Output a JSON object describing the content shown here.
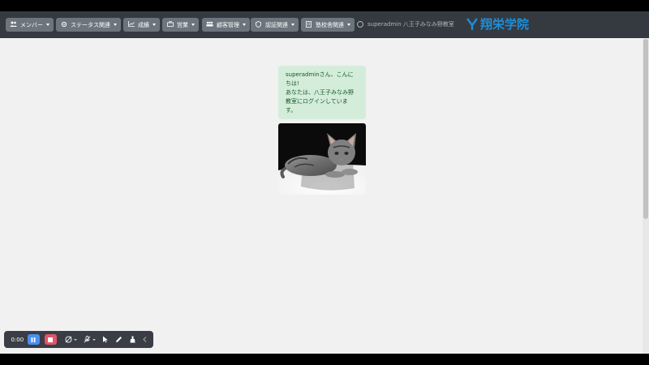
{
  "nav": {
    "items": [
      {
        "label": "メンバー",
        "icon": "users-icon"
      },
      {
        "label": "ステータス関連",
        "icon": "gear-icon"
      },
      {
        "label": "成績",
        "icon": "chart-line-icon"
      },
      {
        "label": "営業",
        "icon": "briefcase-icon"
      },
      {
        "label": "顧客管理",
        "icon": "customers-icon"
      },
      {
        "label": "認証関連",
        "icon": "shield-icon"
      },
      {
        "label": "塾校舎関連",
        "icon": "building-icon"
      }
    ],
    "user_text": "superadmin 八王子みなみ野教室",
    "logo_text": "翔栄学院",
    "colors": {
      "navbar": "#343a40",
      "button": "#6c757d",
      "logo": "#1e8ed8"
    }
  },
  "greeting": {
    "line1": "superadminさん、こんにちは!",
    "line2": "あなたは、八王子みなみ野教室にログインしています。",
    "colors": {
      "background": "#d4edda",
      "text": "#155724"
    }
  },
  "photo": {
    "subject": "kitten-photo"
  },
  "recorder": {
    "time": "0:00",
    "colors": {
      "pause": "#4a8ff0",
      "stop": "#e0566a"
    }
  }
}
